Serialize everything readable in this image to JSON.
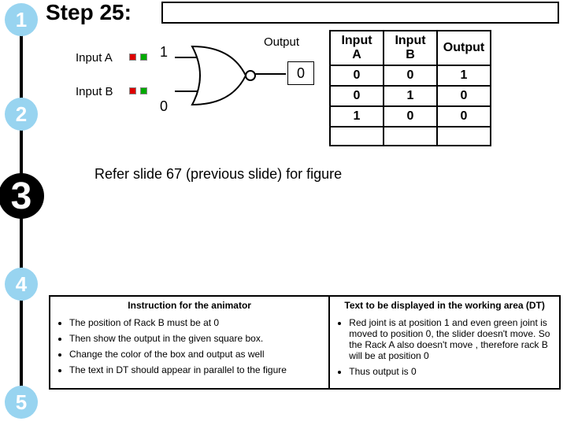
{
  "stepper": [
    "1",
    "2",
    "3",
    "4",
    "5"
  ],
  "active_step_index": 2,
  "title": "Step 25:",
  "diagram": {
    "input_a_label": "Input A",
    "input_b_label": "Input B",
    "val_a": "1",
    "val_b": "0",
    "output_label": "Output",
    "output_val": "0"
  },
  "truth_table": {
    "headers": [
      "Input A",
      "Input B",
      "Output"
    ],
    "rows": [
      [
        "0",
        "0",
        "1"
      ],
      [
        "0",
        "1",
        "0"
      ],
      [
        "1",
        "0",
        "0"
      ],
      [
        "",
        "",
        ""
      ]
    ]
  },
  "refer_note": "Refer slide 67 (previous slide) for figure",
  "instruction": {
    "left_header": "Instruction for the animator",
    "left_items": [
      "The position of Rack B must be at 0",
      "Then show the output in the given square box.",
      "Change the color of the box and output as well",
      "The text in DT should appear  in parallel to the figure"
    ],
    "right_header": "Text to be displayed in the working area (DT)",
    "right_items": [
      "Red joint is at position 1 and even green joint is moved to position 0, the slider doesn't move. So the Rack A also doesn't move , therefore rack B will be at position 0",
      "Thus output is 0"
    ]
  }
}
